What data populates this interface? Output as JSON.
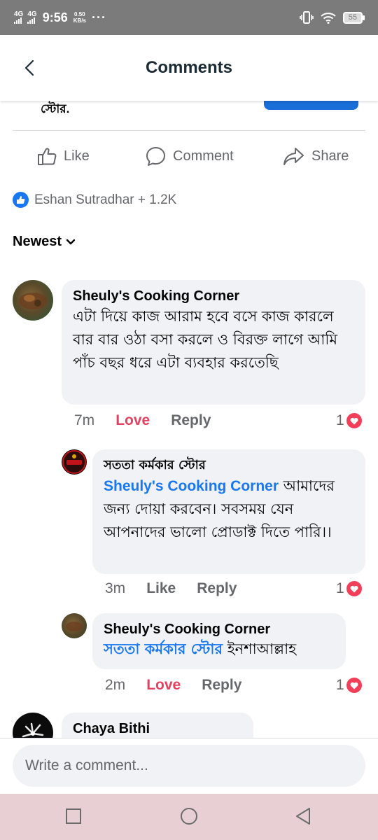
{
  "status_bar": {
    "network_1": "4G",
    "network_2": "4G",
    "time": "9:56",
    "speed_value": "0.50",
    "speed_unit": "KB/s",
    "more": "···",
    "battery": "55"
  },
  "header": {
    "title": "Comments"
  },
  "post": {
    "text_tail": "স্টোর.",
    "actions": {
      "like": "Like",
      "comment": "Comment",
      "share": "Share"
    },
    "reactors": "Eshan Sutradhar + 1.2K"
  },
  "sort": {
    "label": "Newest"
  },
  "comments": [
    {
      "author": "Sheuly's Cooking Corner",
      "text": "এটা দিয়ে কাজ আরাম হবে  বসে কাজ কারলে বার বার ওঠা বসা করলে ও বিরক্ত লাগে আমি পাঁচ বছর ধরে এটা ব্যবহার করতেছি",
      "time": "7m",
      "reaction_label": "Love",
      "reply_label": "Reply",
      "reaction_count": "1"
    },
    {
      "author": "সততা কর্মকার স্টোর",
      "mention": "Sheuly's Cooking Corner",
      "text": " আমাদের জন্য দোয়া করবেন। সবসময় যেন আপনাদের ভালো প্রোডাক্ট দিতে পারি।।",
      "time": "3m",
      "reaction_label": "Like",
      "reply_label": "Reply",
      "reaction_count": "1"
    },
    {
      "author": "Sheuly's Cooking Corner",
      "mention": "সততা কর্মকার স্টোর",
      "text": " ইনশাআল্লাহ",
      "time": "2m",
      "reaction_label": "Love",
      "reply_label": "Reply",
      "reaction_count": "1"
    },
    {
      "author": "Chaya Bithi"
    }
  ],
  "composer": {
    "placeholder": "Write a comment..."
  },
  "colors": {
    "accent": "#1877f2",
    "love": "#e4405f",
    "bubble": "#f0f2f5",
    "nav_bar": "#e8cfd3"
  },
  "icons": [
    "back-icon",
    "like-icon",
    "comment-icon",
    "share-icon",
    "like-badge-icon",
    "chevron-down-icon",
    "heart-icon",
    "recents-icon",
    "home-icon",
    "back-nav-icon"
  ]
}
